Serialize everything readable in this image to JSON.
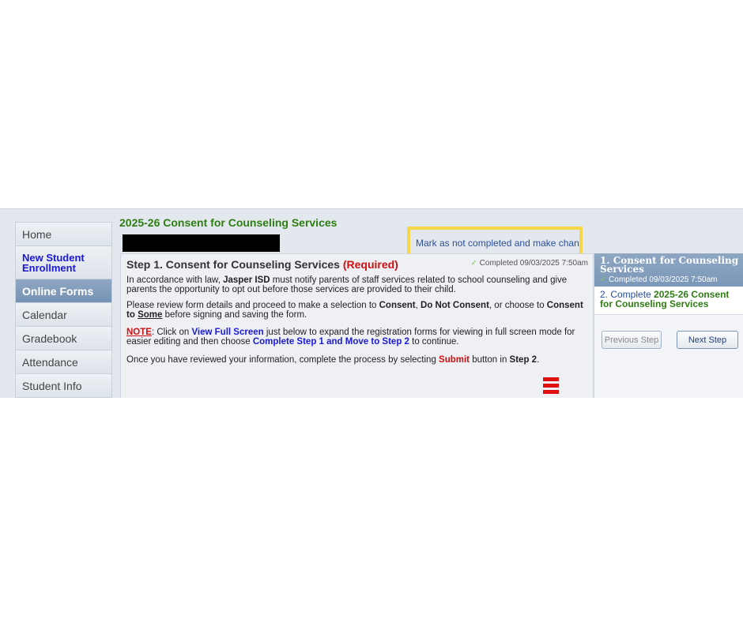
{
  "page_title": "2025-26 Consent for Counseling Services",
  "mark_link": "Mark as not completed and make changes",
  "nav": {
    "items": [
      {
        "label": "Home"
      },
      {
        "label": "New Student Enrollment"
      },
      {
        "label": "Online Forms"
      },
      {
        "label": "Calendar"
      },
      {
        "label": "Gradebook"
      },
      {
        "label": "Attendance"
      },
      {
        "label": "Student Info"
      }
    ]
  },
  "step": {
    "title": "Step 1. Consent for Counseling Services",
    "required": "(Required)",
    "completed_top": "Completed 09/03/2025 7:50am",
    "p1_a": "In accordance with law, ",
    "p1_b": "Jasper ISD",
    "p1_c": " must notify parents of staff services related to school counseling and give parents the opportunity to opt out before those services are provided to their child.",
    "p2_a": "Please review form details and proceed to make a selection to ",
    "p2_b": "Consent",
    "p2_c": ", ",
    "p2_d": "Do Not Consent",
    "p2_e": ", or choose to ",
    "p2_f": "Consent to",
    "p2_g": " ",
    "p2_h": "Some",
    "p2_i": " before signing and saving the form.",
    "p3_a": "NOTE",
    "p3_b": ": Click on ",
    "p3_c": "View Full Screen",
    "p3_d": " just below to expand the registration forms for viewing in full screen mode for easier editing and then choose ",
    "p3_e": "Complete Step 1 and Move to Step 2",
    "p3_f": " to continue.",
    "p4_a": "Once you have reviewed your information, complete the process by selecting ",
    "p4_b": "Submit",
    "p4_c": " button in ",
    "p4_d": "Step 2",
    "p4_e": "."
  },
  "side": {
    "step1_title": "1. Consent for Counseling Services",
    "step1_completed": "Completed 09/03/2025 7:50am",
    "step2_prefix": "2. Complete ",
    "step2_name": "2025-26 Consent for Counseling Services",
    "prev_label": "Previous Step",
    "next_label": "Next Step"
  },
  "colors": {
    "title_green": "#2e7d12",
    "link_blue": "#1a1ad6",
    "required_red": "#d01010",
    "highlight": "#f5d84a"
  },
  "icons": {
    "completed": "check-icon",
    "menu": "hamburger-icon"
  }
}
